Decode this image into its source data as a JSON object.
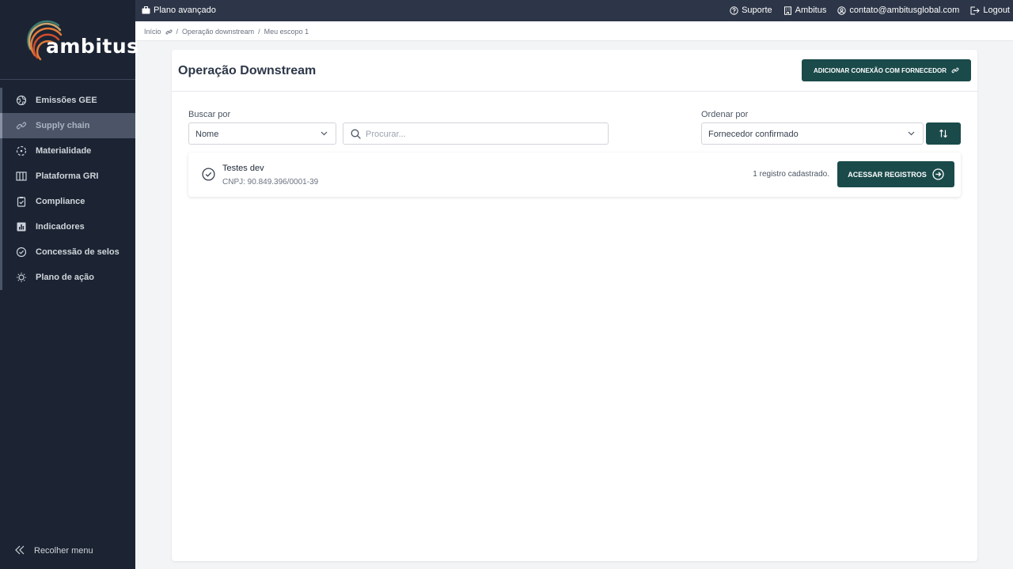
{
  "brand": {
    "name": "ambitus",
    "accent": "#1b4a4a",
    "logo_colors": [
      "#e07b39",
      "#d14d2c",
      "#c9a66b",
      "#3b7a72"
    ]
  },
  "topbar": {
    "plan": "Plano avançado",
    "links": [
      {
        "label": "Suporte",
        "icon": "help-circle-icon"
      },
      {
        "label": "Ambitus",
        "icon": "building-icon"
      },
      {
        "label": "contato@ambitusglobal.com",
        "icon": "user-circle-icon"
      },
      {
        "label": "Logout",
        "icon": "logout-icon"
      }
    ]
  },
  "breadcrumb": {
    "home": "Início",
    "level1": "Operação downstream",
    "level2": "Meu escopo 1",
    "separator": "/"
  },
  "sidebar": {
    "items": [
      {
        "label": "Emissões GEE",
        "icon": "globe-icon",
        "active": false
      },
      {
        "label": "Supply chain",
        "icon": "link-icon",
        "active": true
      },
      {
        "label": "Materialidade",
        "icon": "target-icon",
        "active": false
      },
      {
        "label": "Plataforma GRI",
        "icon": "columns-icon",
        "active": false
      },
      {
        "label": "Compliance",
        "icon": "clipboard-check-icon",
        "active": false
      },
      {
        "label": "Indicadores",
        "icon": "bar-chart-icon",
        "active": false
      },
      {
        "label": "Concessão de selos",
        "icon": "badge-check-icon",
        "active": false
      },
      {
        "label": "Plano de ação",
        "icon": "lightbulb-icon",
        "active": false
      }
    ],
    "collapse_label": "Recolher menu"
  },
  "main": {
    "title": "Operação Downstream",
    "add_button": "ADICIONAR CONEXÃO COM FORNECEDOR",
    "search_by_label": "Buscar por",
    "search_by_value": "Nome",
    "search_placeholder": "Procurar...",
    "order_by_label": "Ordenar por",
    "order_by_value": "Fornecedor confirmado",
    "suppliers": [
      {
        "name": "Testes dev",
        "cnpj": "CNPJ: 90.849.396/0001-39",
        "count_text": "1 registro cadastrado.",
        "button": "ACESSAR REGISTROS"
      }
    ]
  }
}
